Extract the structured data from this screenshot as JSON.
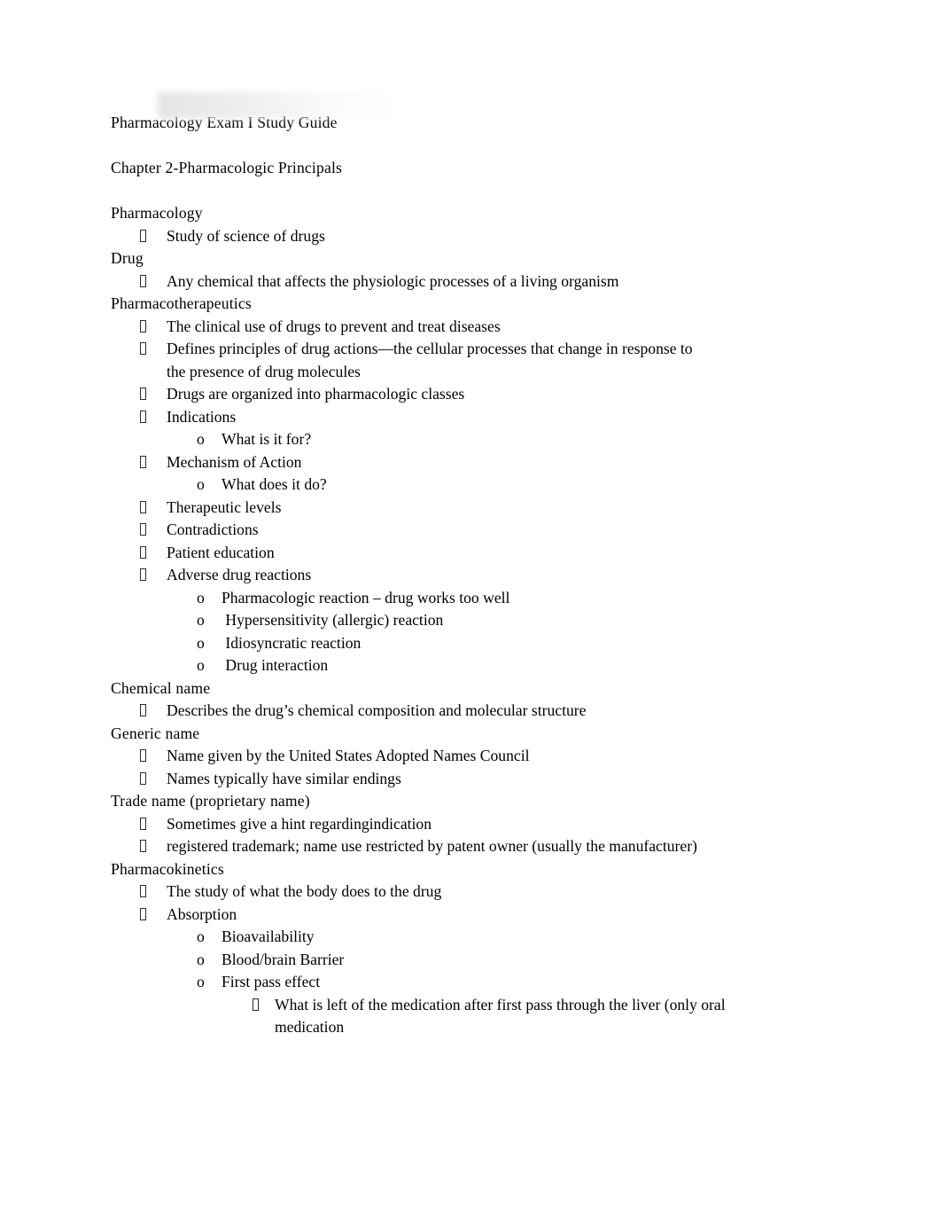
{
  "document": {
    "title": "Pharmacology Exam I Study Guide",
    "chapter_heading": "Chapter 2-Pharmacologic Principals",
    "bullet_marker_level1": "tofu-box",
    "bullet_marker_level2": "o",
    "bullet_marker_level3": "tofu-box",
    "text_color": "#000000",
    "page_color": "#ffffff",
    "highlight_artifact_color": "#e8e8e8"
  },
  "sections": [
    {
      "term": "Pharmacology",
      "items": [
        {
          "level": 1,
          "text": "Study of science of drugs"
        }
      ]
    },
    {
      "term": "Drug",
      "items": [
        {
          "level": 1,
          "text": "Any chemical that affects the physiologic processes of a living organism"
        }
      ]
    },
    {
      "term": "Pharmacotherapeutics",
      "items": [
        {
          "level": 1,
          "text": "The clinical use of drugs to prevent and treat diseases"
        },
        {
          "level": 1,
          "text": "Defines principles of drug actions—the cellular processes that change in response to the presence of drug molecules"
        },
        {
          "level": 1,
          "text": "Drugs are organized into pharmacologic classes"
        },
        {
          "level": 1,
          "text": "Indications"
        },
        {
          "level": 2,
          "text": "What is it for?"
        },
        {
          "level": 1,
          "text": "Mechanism of Action"
        },
        {
          "level": 2,
          "text": "What does it do?"
        },
        {
          "level": 1,
          "text": "Therapeutic levels"
        },
        {
          "level": 1,
          "text": "Contradictions"
        },
        {
          "level": 1,
          "text": "Patient education"
        },
        {
          "level": 1,
          "text": "Adverse drug reactions"
        },
        {
          "level": 2,
          "text": "Pharmacologic reaction – drug works too well"
        },
        {
          "level": 2,
          "text": " Hypersensitivity (allergic) reaction"
        },
        {
          "level": 2,
          "text": " Idiosyncratic reaction"
        },
        {
          "level": 2,
          "text": " Drug interaction"
        }
      ]
    },
    {
      "term": "Chemical name",
      "items": [
        {
          "level": 1,
          "text": "Describes the drug’s chemical composition and molecular structure"
        }
      ]
    },
    {
      "term": "Generic name",
      "items": [
        {
          "level": 1,
          "text": "Name given by the United States Adopted Names Council"
        },
        {
          "level": 1,
          "text": "Names typically have similar endings"
        }
      ]
    },
    {
      "term": "Trade name (proprietary name)",
      "items": [
        {
          "level": 1,
          "text": "Sometimes give a hint regardingindication"
        },
        {
          "level": 1,
          "text": "registered trademark; name use restricted by patent owner (usually the manufacturer)"
        }
      ]
    },
    {
      "term": "Pharmacokinetics",
      "items": [
        {
          "level": 1,
          "text": "The study of what the body does to the drug"
        },
        {
          "level": 1,
          "text": "Absorption"
        },
        {
          "level": 2,
          "text": "Bioavailability"
        },
        {
          "level": 2,
          "text": "Blood/brain Barrier"
        },
        {
          "level": 2,
          "text": "First pass effect"
        },
        {
          "level": 3,
          "text": "What is left of the medication after first pass through the liver (only oral medication"
        }
      ]
    }
  ]
}
